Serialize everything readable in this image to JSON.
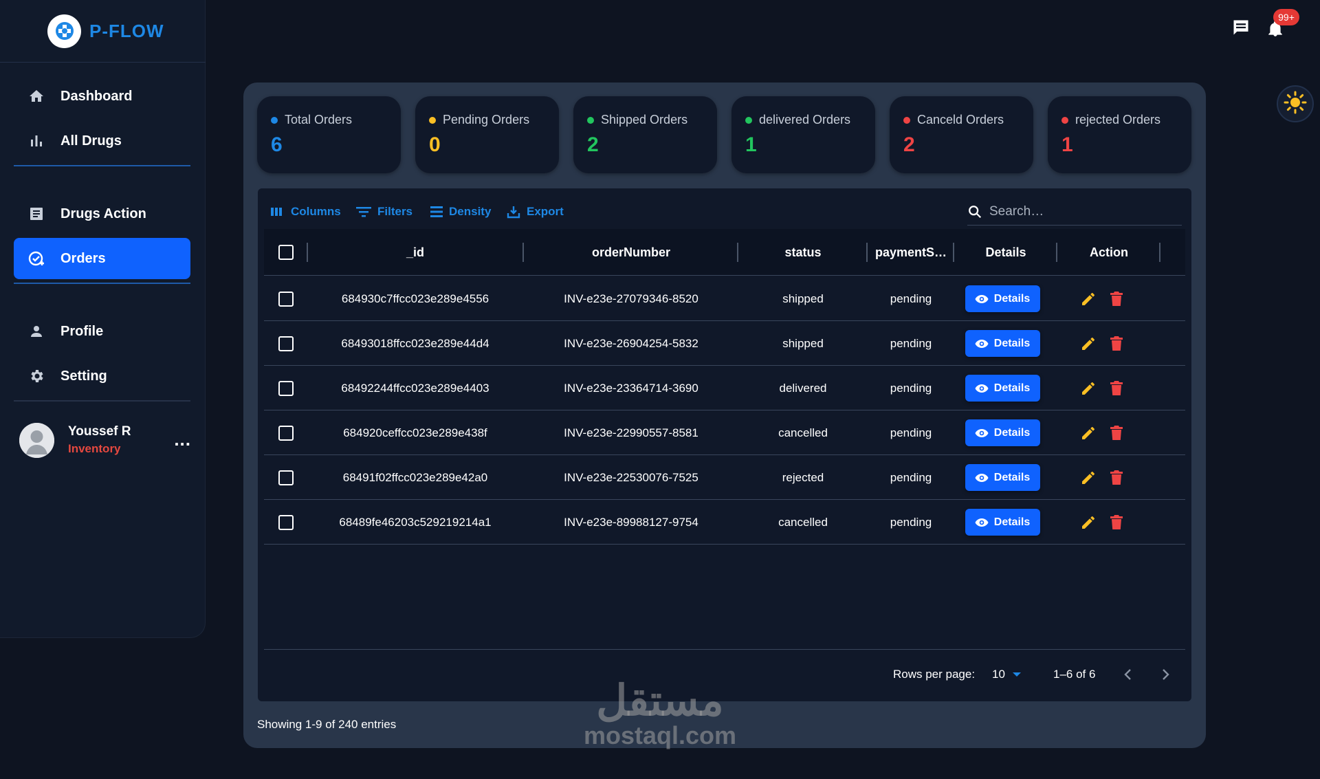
{
  "brand": {
    "name": "P-FLOW"
  },
  "sidebar": {
    "items": [
      {
        "label": "Dashboard",
        "icon": "home-icon"
      },
      {
        "label": "All Drugs",
        "icon": "bar-chart-icon"
      },
      {
        "label": "Drugs Action",
        "icon": "list-alt-icon"
      },
      {
        "label": "Orders",
        "icon": "order-check-icon",
        "active": true
      },
      {
        "label": "Profile",
        "icon": "person-icon"
      },
      {
        "label": "Setting",
        "icon": "gear-icon"
      }
    ],
    "user": {
      "name": "Youssef R",
      "role": "Inventory",
      "more": "..."
    }
  },
  "topbar": {
    "notifications_badge": "99+"
  },
  "stats": [
    {
      "label": "Total Orders",
      "value": "6",
      "color": "#1e88e5"
    },
    {
      "label": "Pending Orders",
      "value": "0",
      "color": "#fbbf24"
    },
    {
      "label": "Shipped Orders",
      "value": "2",
      "color": "#22c55e"
    },
    {
      "label": "delivered Orders",
      "value": "1",
      "color": "#22c55e"
    },
    {
      "label": "Canceld Orders",
      "value": "2",
      "color": "#ef4444"
    },
    {
      "label": "rejected Orders",
      "value": "1",
      "color": "#ef4444"
    }
  ],
  "toolbar": {
    "columns": "Columns",
    "filters": "Filters",
    "density": "Density",
    "export": "Export",
    "search_placeholder": "Search…"
  },
  "table": {
    "headers": [
      "_id",
      "orderNumber",
      "status",
      "paymentS…",
      "Details",
      "Action"
    ],
    "details_label": "Details",
    "rows": [
      {
        "id": "684930c7ffcc023e289e4556",
        "order": "INV-e23e-27079346-8520",
        "status": "shipped",
        "payment": "pending"
      },
      {
        "id": "68493018ffcc023e289e44d4",
        "order": "INV-e23e-26904254-5832",
        "status": "shipped",
        "payment": "pending"
      },
      {
        "id": "68492244ffcc023e289e4403",
        "order": "INV-e23e-23364714-3690",
        "status": "delivered",
        "payment": "pending"
      },
      {
        "id": "684920ceffcc023e289e438f",
        "order": "INV-e23e-22990557-8581",
        "status": "cancelled",
        "payment": "pending"
      },
      {
        "id": "68491f02ffcc023e289e42a0",
        "order": "INV-e23e-22530076-7525",
        "status": "rejected",
        "payment": "pending"
      },
      {
        "id": "68489fe46203c529219214a1",
        "order": "INV-e23e-89988127-9754",
        "status": "cancelled",
        "payment": "pending"
      }
    ]
  },
  "pagination": {
    "rows_label": "Rows per page:",
    "rows_value": "10",
    "range": "1–6 of 6"
  },
  "footer": {
    "showing": "Showing 1-9 of 240 entries"
  },
  "watermark": {
    "arabic": "مستقل",
    "latin": "mostaql.com"
  }
}
